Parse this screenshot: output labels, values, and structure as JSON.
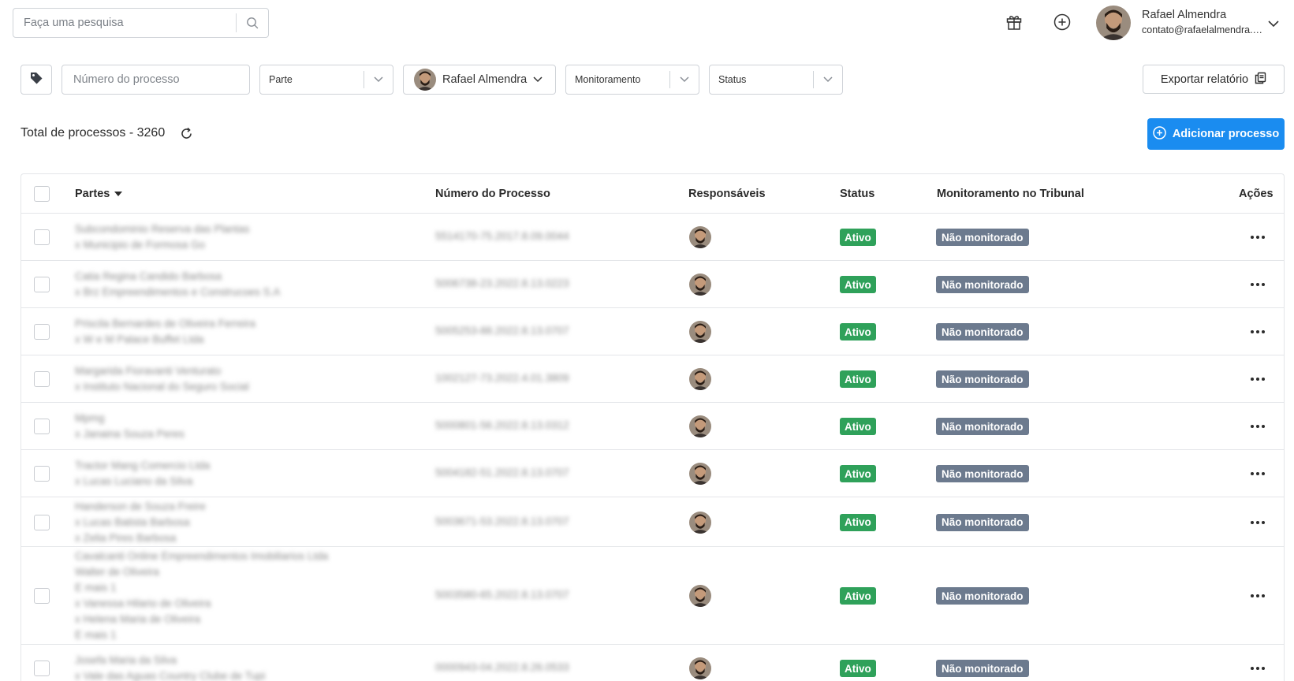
{
  "search": {
    "placeholder": "Faça uma pesquisa"
  },
  "user": {
    "name": "Rafael Almendra",
    "email": "contato@rafaelalmendra.com.br"
  },
  "filters": {
    "process_placeholder": "Número do processo",
    "parte_label": "Parte",
    "responsavel_label": "Rafael Almendra",
    "monitoramento_label": "Monitoramento",
    "status_label": "Status",
    "export_label": "Exportar relatório"
  },
  "summary": {
    "total_label": "Total de processos - 3260",
    "add_label": "Adicionar processo"
  },
  "table": {
    "headers": {
      "partes": "Partes",
      "numero": "Número do Processo",
      "responsaveis": "Responsáveis",
      "status": "Status",
      "monitoramento": "Monitoramento no Tribunal",
      "acoes": "Ações"
    },
    "rows": [
      {
        "parties": [
          "Subcondominio Reserva das Plantas",
          "x Municipio de Formosa Go"
        ],
        "process": "5514170-75.2017.8.09.0044",
        "status": "Ativo",
        "monitor": "Não monitorado"
      },
      {
        "parties": [
          "Catia Regina Candido Barbosa",
          "x Brz Empreendimentos e Construcoes S.A"
        ],
        "process": "5006738-23.2022.8.13.0223",
        "status": "Ativo",
        "monitor": "Não monitorado"
      },
      {
        "parties": [
          "Priscila Bernardes de Oliveira Ferreira",
          "x W e M Palace Buffet Ltda"
        ],
        "process": "5005253-88.2022.8.13.0707",
        "status": "Ativo",
        "monitor": "Não monitorado"
      },
      {
        "parties": [
          "Margarida Fioravanti Venturato",
          "x Instituto Nacional do Seguro Social"
        ],
        "process": "1002127-73.2022.4.01.3809",
        "status": "Ativo",
        "monitor": "Não monitorado"
      },
      {
        "parties": [
          "Mpmg",
          "x Janaina Souza Peres"
        ],
        "process": "5000801-56.2022.8.13.0312",
        "status": "Ativo",
        "monitor": "Não monitorado"
      },
      {
        "parties": [
          "Tractor Mang Comercio Ltda",
          "x Lucas Luciano da Silva"
        ],
        "process": "5004182-51.2022.8.13.0707",
        "status": "Ativo",
        "monitor": "Não monitorado"
      },
      {
        "parties": [
          "Handerson de Souza Freire",
          "x Lucas Batista Barbosa",
          "x Zelia Pires Barbosa"
        ],
        "process": "5003671-53.2022.8.13.0707",
        "status": "Ativo",
        "monitor": "Não monitorado"
      },
      {
        "parties": [
          "Cavalcanti Online Empreendimentos Imobiliarios Ltda",
          "Walter de Oliveira",
          "E mais 1",
          "x Vanessa Hilario de Oliveira",
          "x Helena Maria de Oliveira",
          "E mais 1"
        ],
        "process": "5003580-65.2022.8.13.0707",
        "status": "Ativo",
        "monitor": "Não monitorado"
      },
      {
        "parties": [
          "Josefa Maria da Silva",
          "x Vale das Aguas Country Clube de Tupi"
        ],
        "process": "0000943-04.2022.8.26.0533",
        "status": "Ativo",
        "monitor": "Não monitorado"
      }
    ]
  },
  "colors": {
    "primary": "#1a8cf0",
    "active": "#2fa15a",
    "monitor": "#6c7a8e"
  }
}
